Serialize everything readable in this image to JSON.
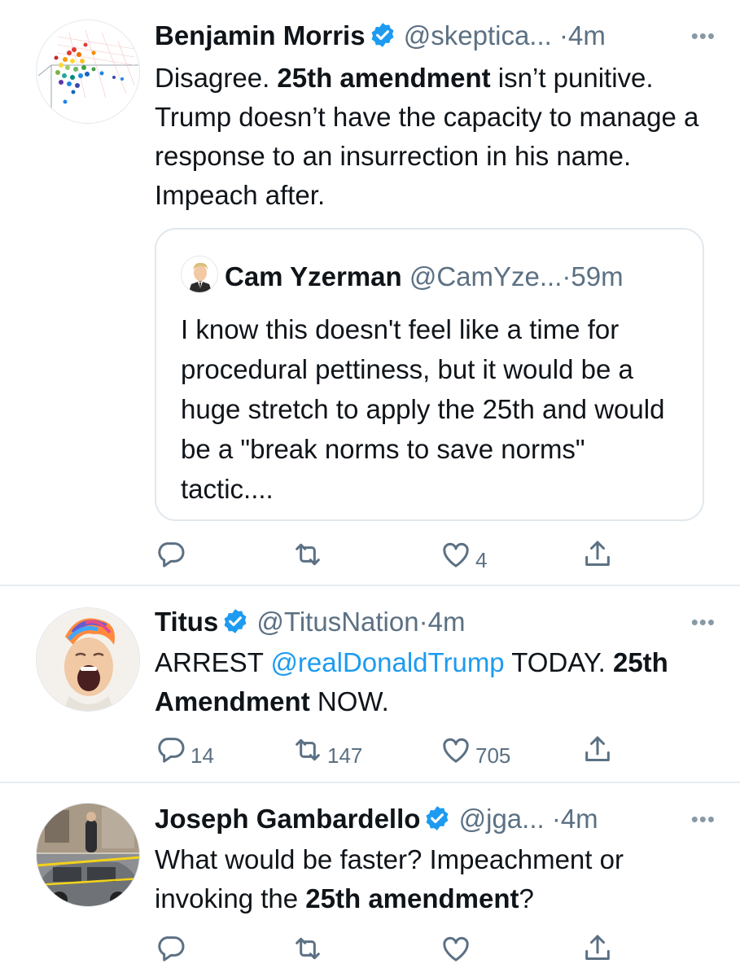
{
  "colors": {
    "text": "#0f1419",
    "secondary": "#5b7083",
    "link": "#1d9bf0",
    "verified": "#1d9bf0",
    "divider": "#e6ecf0"
  },
  "tweets": [
    {
      "name": "Benjamin Morris",
      "verified": true,
      "handle": "@skeptica...",
      "dot": "·",
      "time": "4m",
      "more": "•••",
      "avatar_icon": "scatter-plot-avatar",
      "text_parts": [
        {
          "text": "Disagree. ",
          "bold": false
        },
        {
          "text": "25th amendment",
          "bold": true
        },
        {
          "text": " isn’t punitive. Trump doesn’t have the capacity to manage a response to an insurrection in his name. Impeach after.",
          "bold": false
        }
      ],
      "quote": {
        "name": "Cam Yzerman",
        "handle": "@CamYze...",
        "dot": "·",
        "time": "59m",
        "text": "I know this doesn't feel like a time for procedural pettiness, but it would be a huge stretch to apply the 25th and would be a \"break norms to save norms\" tactic...."
      },
      "actions": {
        "reply": "",
        "retweet": "",
        "like": "4",
        "share": ""
      }
    },
    {
      "name": "Titus",
      "verified": true,
      "handle": "@TitusNation",
      "dot": "·",
      "time": "4m",
      "more": "•••",
      "avatar_icon": "screaming-face-avatar",
      "text_parts": [
        {
          "text": "ARREST ",
          "bold": false
        },
        {
          "text": "@realDonaldTrump",
          "mention": true
        },
        {
          "text": " TODAY. ",
          "bold": false
        },
        {
          "text": "25th Amendment",
          "bold": true
        },
        {
          "text": " NOW.",
          "bold": false
        }
      ],
      "actions": {
        "reply": "14",
        "retweet": "147",
        "like": "705",
        "share": ""
      }
    },
    {
      "name": "Joseph Gambardello",
      "verified": true,
      "handle": "@jga...",
      "dot": "·",
      "time": "4m",
      "more": "•••",
      "avatar_icon": "street-photo-avatar",
      "text_parts": [
        {
          "text": "What would be faster? Impeachment or invoking the ",
          "bold": false
        },
        {
          "text": "25th amendment",
          "bold": true
        },
        {
          "text": "?",
          "bold": false
        }
      ],
      "actions": {
        "reply": "",
        "retweet": "",
        "like": "",
        "share": ""
      }
    }
  ]
}
